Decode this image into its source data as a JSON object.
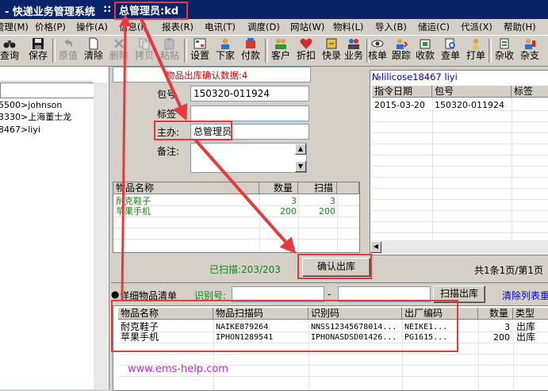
{
  "titlebar": {
    "app_title": "- 快递业务管理系统",
    "separator": "::",
    "user_label": "总管理员:kd"
  },
  "menu": [
    {
      "label": "管理(M)"
    },
    {
      "label": "价格(P)"
    },
    {
      "label": "操作(A)"
    },
    {
      "label": "信息(I)"
    },
    {
      "label": "报表(R)"
    },
    {
      "label": "电讯(T)"
    },
    {
      "label": "调度(D)"
    },
    {
      "label": "网站(W)"
    },
    {
      "label": "物料(L)"
    },
    {
      "label": "导入(B)"
    },
    {
      "label": "储运(C)"
    },
    {
      "label": "代派(X)"
    },
    {
      "label": "帮助(H)"
    }
  ],
  "toolbar": [
    {
      "label": "查询",
      "icon": "binoculars-icon"
    },
    {
      "label": "保存",
      "icon": "floppy-icon"
    },
    {
      "label": "原值",
      "icon": "undo-icon"
    },
    {
      "label": "清除",
      "icon": "clear-icon"
    },
    {
      "label": "删除",
      "icon": "delete-icon"
    },
    {
      "label": "拷贝",
      "icon": "copy-icon"
    },
    {
      "label": "粘贴",
      "icon": "paste-icon"
    },
    {
      "label": "设置",
      "icon": "settings-icon"
    },
    {
      "label": "下家",
      "icon": "next-party-icon"
    },
    {
      "label": "付款",
      "icon": "payment-icon"
    },
    {
      "label": "客户",
      "icon": "customer-icon"
    },
    {
      "label": "折扣",
      "icon": "discount-icon"
    },
    {
      "label": "快录",
      "icon": "quick-entry-icon"
    },
    {
      "label": "业务",
      "icon": "business-icon"
    },
    {
      "label": "核单",
      "icon": "verify-icon"
    },
    {
      "label": "跟踪",
      "icon": "track-icon"
    },
    {
      "label": "收款",
      "icon": "receive-icon"
    },
    {
      "label": "查单",
      "icon": "search-order-icon"
    },
    {
      "label": "打单",
      "icon": "print-order-icon"
    },
    {
      "label": "杂收",
      "icon": "misc-receive-icon"
    },
    {
      "label": "杂支",
      "icon": "misc-pay-icon"
    }
  ],
  "left_list": [
    "5500>johnson",
    "3330>上海董士龙",
    "8467>liyi"
  ],
  "form": {
    "title": "物品出库确认数据:4",
    "package_label": "包号",
    "package_value": "150320-011924",
    "tag_label": "标签",
    "tag_value": "",
    "handler_label": "主办:",
    "handler_value": "总管理员",
    "note_label": "备注:",
    "note_value": ""
  },
  "items_table": {
    "headers": [
      "物品名称",
      "数量",
      "扫描"
    ],
    "rows": [
      [
        "耐克鞋子",
        "3",
        "3"
      ],
      [
        "苹果手机",
        "200",
        "200"
      ]
    ]
  },
  "scanned_label": "已扫描:203/203",
  "confirm_button": "确认出库",
  "right_panel": {
    "title": "№lilicose18467 liyi",
    "headers": [
      "指令日期",
      "包号",
      "标签"
    ],
    "rows": [
      [
        "2015-03-20",
        "150320-011924",
        ""
      ]
    ],
    "pagination": "共1条1页/第1页"
  },
  "detail": {
    "title": "详细物品清单",
    "id_label": "识别号:",
    "id_from": "",
    "dash": "-",
    "id_to": "",
    "scan_out_button": "扫描出库",
    "clear_link": "清除列表重",
    "headers": [
      "物品名称",
      "物品扫描码",
      "识别码",
      "出厂编码",
      "数量",
      "类型"
    ],
    "rows": [
      [
        "耐克鞋子",
        "NAIKE879264",
        "NNSS12345678014...",
        "NEIKE1...",
        "3",
        "出库"
      ],
      [
        "苹果手机",
        "IPHON1289541",
        "IPHONASDSD01426...",
        "PG1615...",
        "200",
        "出库"
      ]
    ]
  },
  "watermark": "www.ems-help.com",
  "colors": {
    "titlebar": "#0a246a",
    "annotation": "#e8393c",
    "green_text": "#138a13",
    "red_text": "#d40000"
  }
}
